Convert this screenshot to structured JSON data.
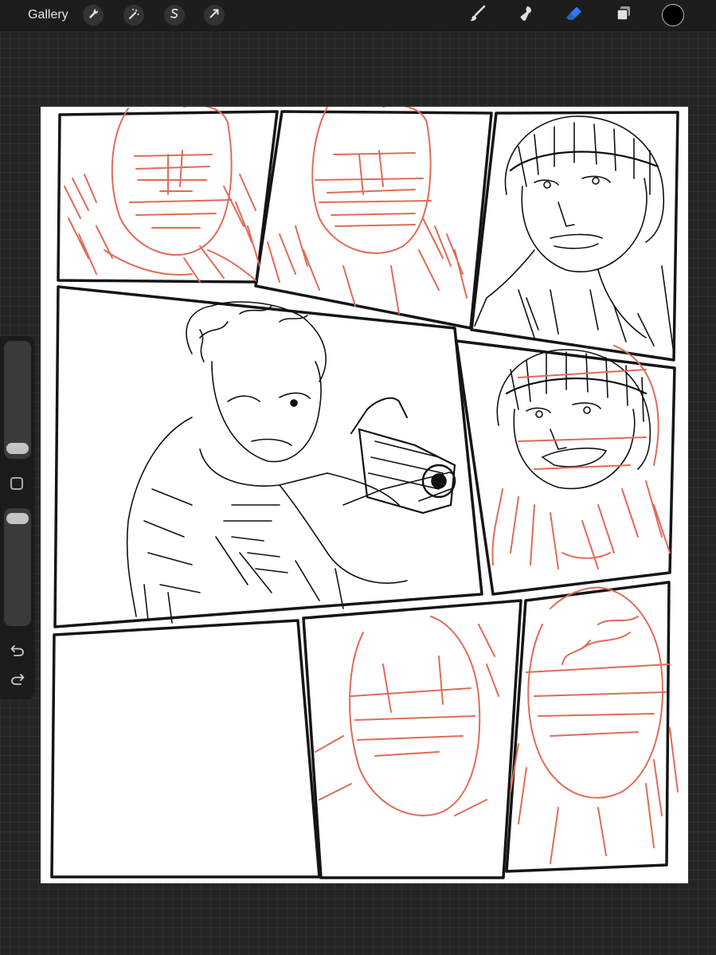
{
  "app": {
    "gallery_label": "Gallery"
  },
  "toolbar": {
    "left_icons": [
      "wrench-icon",
      "magic-wand-icon",
      "selection-s-icon",
      "transform-arrow-icon"
    ],
    "right_icons": [
      "brush-icon",
      "smudge-icon",
      "eraser-icon",
      "layers-icon"
    ],
    "active_tool": "eraser",
    "active_color": "#000000",
    "accent_color": "#2f7bf5"
  },
  "sidebar": {
    "brush_size_level": 0.3,
    "opacity_level": 1.0,
    "icons": [
      "modify-square-icon",
      "undo-icon",
      "redo-icon"
    ]
  },
  "canvas": {
    "background": "#ffffff",
    "ink_color": "#111111",
    "sketch_color": "#e06b58",
    "panels": [
      {
        "id": "panel-1",
        "state": "sketch"
      },
      {
        "id": "panel-2",
        "state": "sketch"
      },
      {
        "id": "panel-3",
        "state": "inked"
      },
      {
        "id": "panel-4",
        "state": "inked"
      },
      {
        "id": "panel-5",
        "state": "partially-inked"
      },
      {
        "id": "panel-6",
        "state": "empty"
      },
      {
        "id": "panel-7",
        "state": "sketch"
      },
      {
        "id": "panel-8",
        "state": "sketch"
      }
    ]
  }
}
